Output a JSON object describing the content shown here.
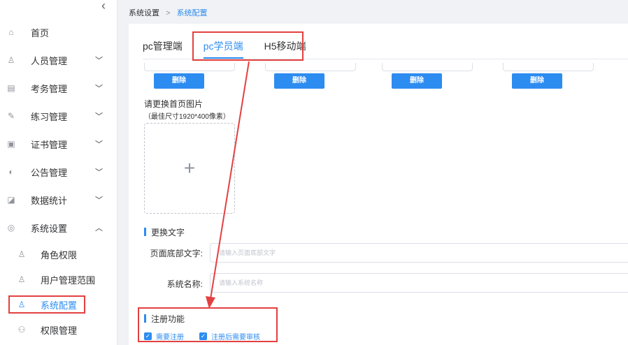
{
  "breadcrumb": {
    "parent": "系统设置",
    "separator": ">",
    "current": "系统配置"
  },
  "sidebar": {
    "collapse_glyph": "‹",
    "items": [
      {
        "label": "首页",
        "icon": "home-icon",
        "glyph": "⌂"
      },
      {
        "label": "人员管理",
        "icon": "user-icon",
        "glyph": "♙"
      },
      {
        "label": "考务管理",
        "icon": "document-icon",
        "glyph": "▤"
      },
      {
        "label": "练习管理",
        "icon": "edit-icon",
        "glyph": "✎"
      },
      {
        "label": "证书管理",
        "icon": "certificate-icon",
        "glyph": "▣"
      },
      {
        "label": "公告管理",
        "icon": "announcement-icon",
        "glyph": "◐"
      },
      {
        "label": "数据统计",
        "icon": "chart-icon",
        "glyph": "◪"
      },
      {
        "label": "系统设置",
        "icon": "settings-icon",
        "glyph": "◎"
      }
    ],
    "subitems": [
      {
        "label": "角色权限",
        "icon": "role-icon",
        "glyph": "♙"
      },
      {
        "label": "用户管理范围",
        "icon": "user-scope-icon",
        "glyph": "♙"
      },
      {
        "label": "系统配置",
        "icon": "config-icon",
        "glyph": "♙"
      },
      {
        "label": "权限管理",
        "icon": "permission-icon",
        "glyph": "⚇"
      }
    ]
  },
  "tabs": [
    {
      "label": "pc管理端"
    },
    {
      "label": "pc学员端"
    },
    {
      "label": "H5移动端"
    }
  ],
  "delete_button": "删除",
  "upload": {
    "title": "请更换首页图片",
    "hint": "（最佳尺寸1920*400像素）",
    "plus": "+"
  },
  "text_section": {
    "title": "更换文字",
    "footer_label": "页面底部文字:",
    "footer_placeholder": "请输入页面底部文字",
    "name_label": "系统名称:",
    "name_placeholder": "请输入系统名称"
  },
  "register_section": {
    "title": "注册功能",
    "options": [
      "需要注册",
      "注册后需要审核"
    ]
  },
  "colors": {
    "accent": "#2d8cf0",
    "annotation": "#e34040"
  }
}
